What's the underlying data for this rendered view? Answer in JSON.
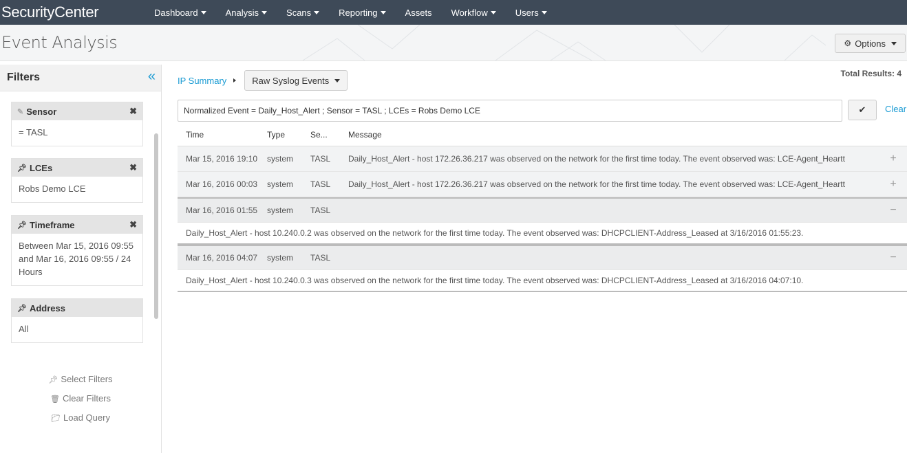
{
  "app": {
    "brand": "SecurityCenter",
    "nav": [
      "Dashboard",
      "Analysis",
      "Scans",
      "Reporting",
      "Assets",
      "Workflow",
      "Users"
    ],
    "nav_caret": [
      true,
      true,
      true,
      true,
      false,
      true,
      true
    ]
  },
  "page": {
    "title": "Event Analysis",
    "options_label": "Options"
  },
  "sidebar": {
    "title": "Filters",
    "filters": [
      {
        "label": "Sensor",
        "value": "= TASL"
      },
      {
        "label": "LCEs",
        "value": "Robs Demo LCE"
      },
      {
        "label": "Timeframe",
        "value": "Between Mar 15, 2016 09:55 and Mar 16, 2016 09:55 / 24 Hours"
      },
      {
        "label": "Address",
        "value": "All"
      }
    ],
    "actions": [
      "Select Filters",
      "Clear Filters",
      "Load Query"
    ]
  },
  "main": {
    "breadcrumb_link": "IP Summary",
    "view_select": "Raw Syslog Events",
    "total_results": "Total Results: 4",
    "query": "Normalized Event = Daily_Host_Alert ; Sensor = TASL ; LCEs = Robs Demo LCE",
    "clear_label": "Clear",
    "columns": [
      "Time",
      "Type",
      "Se...",
      "Message"
    ],
    "rows": [
      {
        "time": "Mar 15, 2016 19:10",
        "type": "system",
        "sensor": "TASL",
        "message": "Daily_Host_Alert - host 172.26.36.217 was observed on the network for the first time today. The event observed was: LCE-Agent_Heartt",
        "action": "+",
        "detail": ""
      },
      {
        "time": "Mar 16, 2016 00:03",
        "type": "system",
        "sensor": "TASL",
        "message": "Daily_Host_Alert - host 172.26.36.217 was observed on the network for the first time today. The event observed was: LCE-Agent_Heartt",
        "action": "+",
        "detail": ""
      },
      {
        "time": "Mar 16, 2016 01:55",
        "type": "system",
        "sensor": "TASL",
        "message": "",
        "action": "−",
        "detail": "Daily_Host_Alert - host 10.240.0.2 was observed on the network for the first time today. The event observed was: DHCPCLIENT-Address_Leased at 3/16/2016 01:55:23."
      },
      {
        "time": "Mar 16, 2016 04:07",
        "type": "system",
        "sensor": "TASL",
        "message": "",
        "action": "−",
        "detail": "Daily_Host_Alert - host 10.240.0.3 was observed on the network for the first time today. The event observed was: DHCPCLIENT-Address_Leased at 3/16/2016 04:07:10."
      }
    ]
  },
  "colors": {
    "nav_bg": "#3e4a58",
    "accent": "#1a9bd3"
  }
}
